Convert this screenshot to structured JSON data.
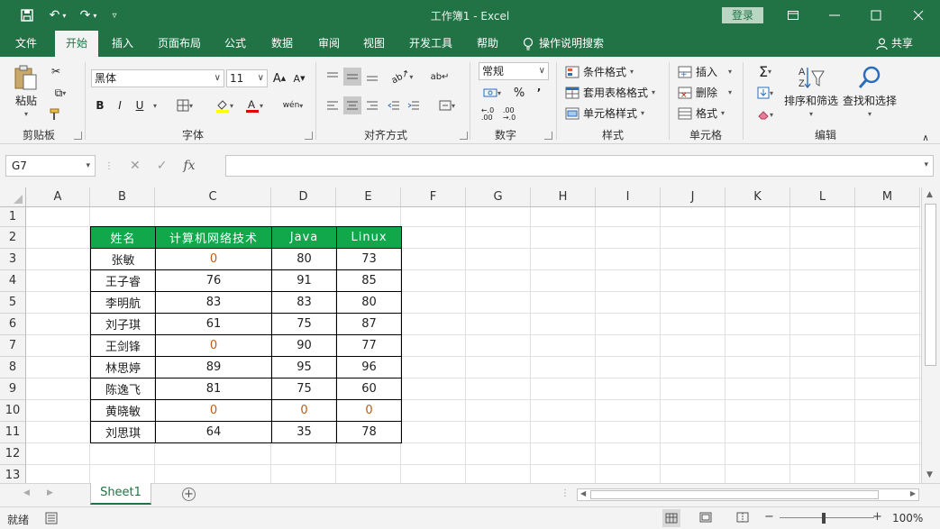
{
  "window": {
    "title": "工作簿1  -  Excel",
    "login_label": "登录"
  },
  "menu": {
    "tabs": [
      "文件",
      "开始",
      "插入",
      "页面布局",
      "公式",
      "数据",
      "审阅",
      "视图",
      "开发工具",
      "帮助"
    ],
    "active": "开始",
    "tell_me": "操作说明搜索",
    "share": "共享"
  },
  "ribbon": {
    "clipboard": {
      "paste": "粘贴",
      "label": "剪贴板"
    },
    "font": {
      "name": "黑体",
      "size": "11",
      "label": "字体",
      "bold": "B",
      "italic": "I",
      "underline": "U",
      "wen": "wén"
    },
    "alignment": {
      "label": "对齐方式"
    },
    "number": {
      "format": "常规",
      "label": "数字",
      "percent": "%",
      "comma": "’"
    },
    "styles": {
      "conditional": "条件格式",
      "table": "套用表格格式",
      "cell": "单元格样式",
      "label": "样式"
    },
    "cells": {
      "insert": "插入",
      "delete": "删除",
      "format": "格式",
      "label": "单元格"
    },
    "editing": {
      "sort": "排序和筛选",
      "find": "查找和选择",
      "label": "编辑"
    }
  },
  "formula_bar": {
    "name_box": "G7",
    "fx": "fx",
    "value": ""
  },
  "grid": {
    "columns": [
      "A",
      "B",
      "C",
      "D",
      "E",
      "F",
      "G",
      "H",
      "I",
      "J",
      "K",
      "L",
      "M"
    ],
    "rows": [
      "1",
      "2",
      "3",
      "4",
      "5",
      "6",
      "7",
      "8",
      "9",
      "10",
      "11",
      "12",
      "13"
    ]
  },
  "table": {
    "headers": [
      "姓名",
      "计算机网络技术",
      "Java",
      "Linux"
    ],
    "rows": [
      [
        "张敏",
        "0",
        "80",
        "73"
      ],
      [
        "王子睿",
        "76",
        "91",
        "85"
      ],
      [
        "李明航",
        "83",
        "83",
        "80"
      ],
      [
        "刘子琪",
        "61",
        "75",
        "87"
      ],
      [
        "王剑锋",
        "0",
        "90",
        "77"
      ],
      [
        "林思婷",
        "89",
        "95",
        "96"
      ],
      [
        "陈逸飞",
        "81",
        "75",
        "60"
      ],
      [
        "黄晓敏",
        "0",
        "0",
        "0"
      ],
      [
        "刘思琪",
        "64",
        "35",
        "78"
      ]
    ]
  },
  "sheets": {
    "tabs": [
      "Sheet1"
    ]
  },
  "status": {
    "text": "就绪",
    "zoom": "100%"
  },
  "colors": {
    "accent": "#217346",
    "header_fill": "#11a84b",
    "zero_text": "#c55a11"
  }
}
